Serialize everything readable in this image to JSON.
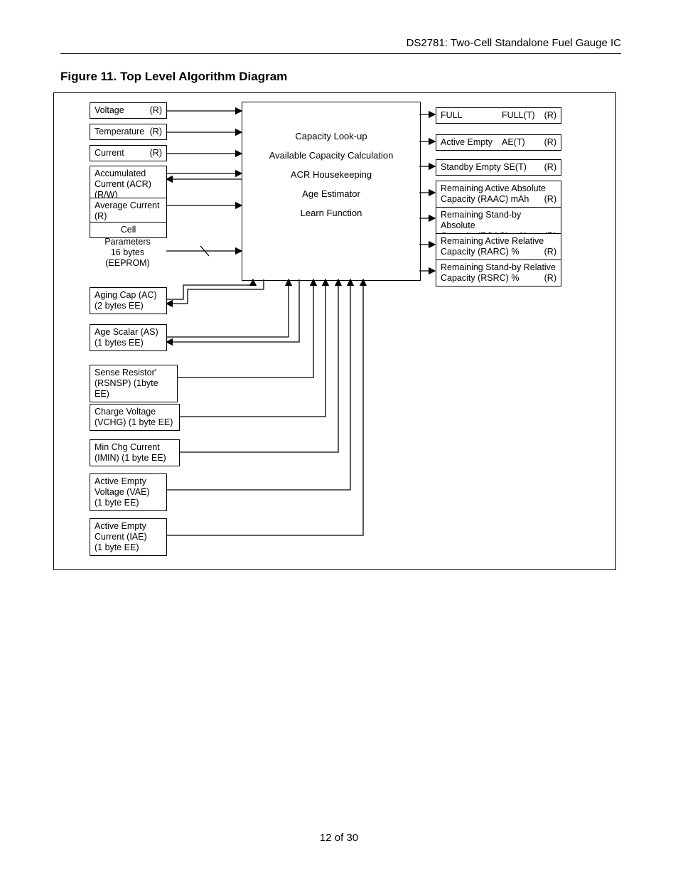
{
  "header": {
    "title": "DS2781: Two-Cell Standalone Fuel Gauge IC"
  },
  "figure_title": "Figure 11. Top Level Algorithm Diagram",
  "inputs": {
    "voltage": {
      "label": "Voltage",
      "tag": "(R)"
    },
    "temperature": {
      "label": "Temperature",
      "tag": "(R)"
    },
    "current": {
      "label": "Current",
      "tag": "(R)"
    },
    "acr": {
      "label": "Accumulated Current (ACR)",
      "tag": "(R/W)"
    },
    "avg_current": {
      "label": "Average Current",
      "tag": "(R)"
    },
    "cell_params": {
      "l1": "Cell",
      "l2": "Parameters",
      "l3": "16 bytes",
      "l4": "(EEPROM)"
    }
  },
  "center": {
    "l1": "Capacity Look-up",
    "l2": "Available Capacity Calculation",
    "l3": "ACR Housekeeping",
    "l4": "Age Estimator",
    "l5": "Learn Function"
  },
  "outputs": {
    "full": {
      "label": "FULL",
      "mid": "FULL(T)",
      "tag": "(R)"
    },
    "active_empty": {
      "label": "Active Empty",
      "mid": "AE(T)",
      "tag": "(R)"
    },
    "standby_empty": {
      "label": "Standby Empty",
      "mid": "SE(T)",
      "tag": "(R)"
    },
    "raac": {
      "l1": "Remaining Active Absolute",
      "l2": "Capacity (RAAC) mAh",
      "tag": "(R)"
    },
    "rsac": {
      "l1": "Remaining Stand-by Absolute",
      "l2": "Capacity (RSAC) mAh",
      "tag": "(R)"
    },
    "rarc": {
      "l1": "Remaining Active Relative",
      "l2": "Capacity (RARC) %",
      "tag": "(R)"
    },
    "rsrc": {
      "l1": "Remaining Stand-by Relative",
      "l2": "Capacity (RSRC) %",
      "tag": "(R)"
    }
  },
  "ee": {
    "ac": {
      "l1": "Aging Cap (AC)",
      "l2": "(2 bytes EE)"
    },
    "as": {
      "l1": "Age Scalar (AS)",
      "l2": " (1 bytes EE)"
    },
    "rsnsp": {
      "l1": "Sense Resistor'",
      "l2": "(RSNSP) (1byte EE)"
    },
    "vchg": {
      "l1": "Charge Voltage",
      "l2": "(VCHG)  (1 byte EE)"
    },
    "imin": {
      "l1": "Min Chg Current",
      "l2": "(IMIN)   (1 byte EE)"
    },
    "vae": {
      "l1": "Active Empty",
      "l2": "Voltage (VAE)",
      "l3": "(1 byte EE)"
    },
    "iae": {
      "l1": "Active Empty",
      "l2": "Current (IAE)",
      "l3": "(1 byte EE)"
    }
  },
  "footer": {
    "page": "12 of 30"
  }
}
